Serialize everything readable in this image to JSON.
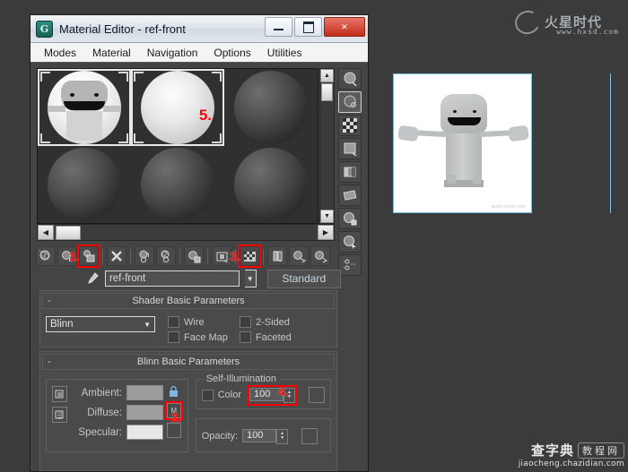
{
  "window": {
    "title": "Material Editor - ref-front",
    "app_icon": "max-logo-icon",
    "buttons": {
      "minimize": "minimize-icon",
      "maximize": "maximize-icon",
      "close": "×"
    }
  },
  "menubar": {
    "items": [
      "Modes",
      "Material",
      "Navigation",
      "Options",
      "Utilities"
    ]
  },
  "sample_slots": [
    {
      "name": "slot-1",
      "type": "face",
      "active": true,
      "annotation": ""
    },
    {
      "name": "slot-2",
      "type": "bright",
      "active": true,
      "annotation": "5."
    },
    {
      "name": "slot-3",
      "type": "sphere",
      "active": false,
      "annotation": ""
    },
    {
      "name": "slot-4",
      "type": "sphere",
      "active": false,
      "annotation": ""
    },
    {
      "name": "slot-5",
      "type": "sphere",
      "active": false,
      "annotation": ""
    },
    {
      "name": "slot-6",
      "type": "sphere",
      "active": false,
      "annotation": ""
    }
  ],
  "slot_scroll": {
    "up": "▲",
    "down": "▼",
    "left": "◀",
    "right": "▶"
  },
  "vertical_tools": [
    "sample-type-sphere-icon",
    "backlight-icon",
    "background-checker-icon",
    "sample-uv-tiling-icon",
    "video-color-check-icon",
    "make-preview-icon",
    "options-icon",
    "select-by-material-icon",
    "material-id-channel-icon"
  ],
  "material_toolbar": [
    {
      "name": "get-material-icon",
      "annotation": ""
    },
    {
      "name": "put-material-to-scene-icon",
      "annotation": ""
    },
    {
      "name": "assign-material-to-selection-icon",
      "annotation": "1."
    },
    {
      "name": "reset-map-icon",
      "annotation": ""
    },
    {
      "name": "make-material-copy-icon",
      "annotation": ""
    },
    {
      "name": "make-unique-icon",
      "annotation": ""
    },
    {
      "name": "put-to-library-icon",
      "annotation": ""
    },
    {
      "name": "material-effects-channel-icon",
      "annotation": ""
    },
    {
      "name": "show-map-in-viewport-icon",
      "annotation": "3."
    },
    {
      "name": "show-end-result-icon",
      "annotation": ""
    },
    {
      "name": "go-to-parent-icon",
      "annotation": ""
    },
    {
      "name": "go-forward-to-sibling-icon",
      "annotation": ""
    }
  ],
  "name_row": {
    "eyedropper": "eyedropper-icon",
    "material_name": "ref-front",
    "dropdown_arrow": "▼",
    "type_button": "Standard"
  },
  "shader_rollout": {
    "title": "Shader Basic Parameters",
    "collapse": "-",
    "shader": "Blinn",
    "dropdown_arrow": "▼",
    "checkboxes": [
      {
        "label": "Wire",
        "checked": false
      },
      {
        "label": "2-Sided",
        "checked": false
      },
      {
        "label": "Face Map",
        "checked": false
      },
      {
        "label": "Faceted",
        "checked": false
      }
    ]
  },
  "blinn_rollout": {
    "title": "Blinn Basic Parameters",
    "collapse": "-",
    "colors": [
      {
        "label": "Ambient:",
        "swatch": "#9b9b9b"
      },
      {
        "label": "Diffuse:",
        "swatch": "#9e9e9e"
      },
      {
        "label": "Specular:",
        "swatch": "#e7e7e7"
      }
    ],
    "lock_icon": "lock-icon",
    "map_button_label": "M",
    "map_button_annotation": "2.",
    "self_illumination": {
      "label": "Self-Illumination",
      "color_checkbox_label": "Color",
      "color_checked": false,
      "value": "100",
      "annotation": "4."
    },
    "opacity": {
      "label": "Opacity:",
      "value": "100"
    }
  },
  "viewport": {
    "name": "perspective-render-view",
    "background": "#ffffff",
    "border_color": "#7ec1e3",
    "caption": "www.hxsd.com"
  },
  "watermark_top": {
    "cn": "火星时代",
    "url": "www.hxsd.com"
  },
  "watermark_bottom": {
    "cn": "查字典",
    "pill": "教程网",
    "url": "jiaocheng.chazidian.com"
  }
}
